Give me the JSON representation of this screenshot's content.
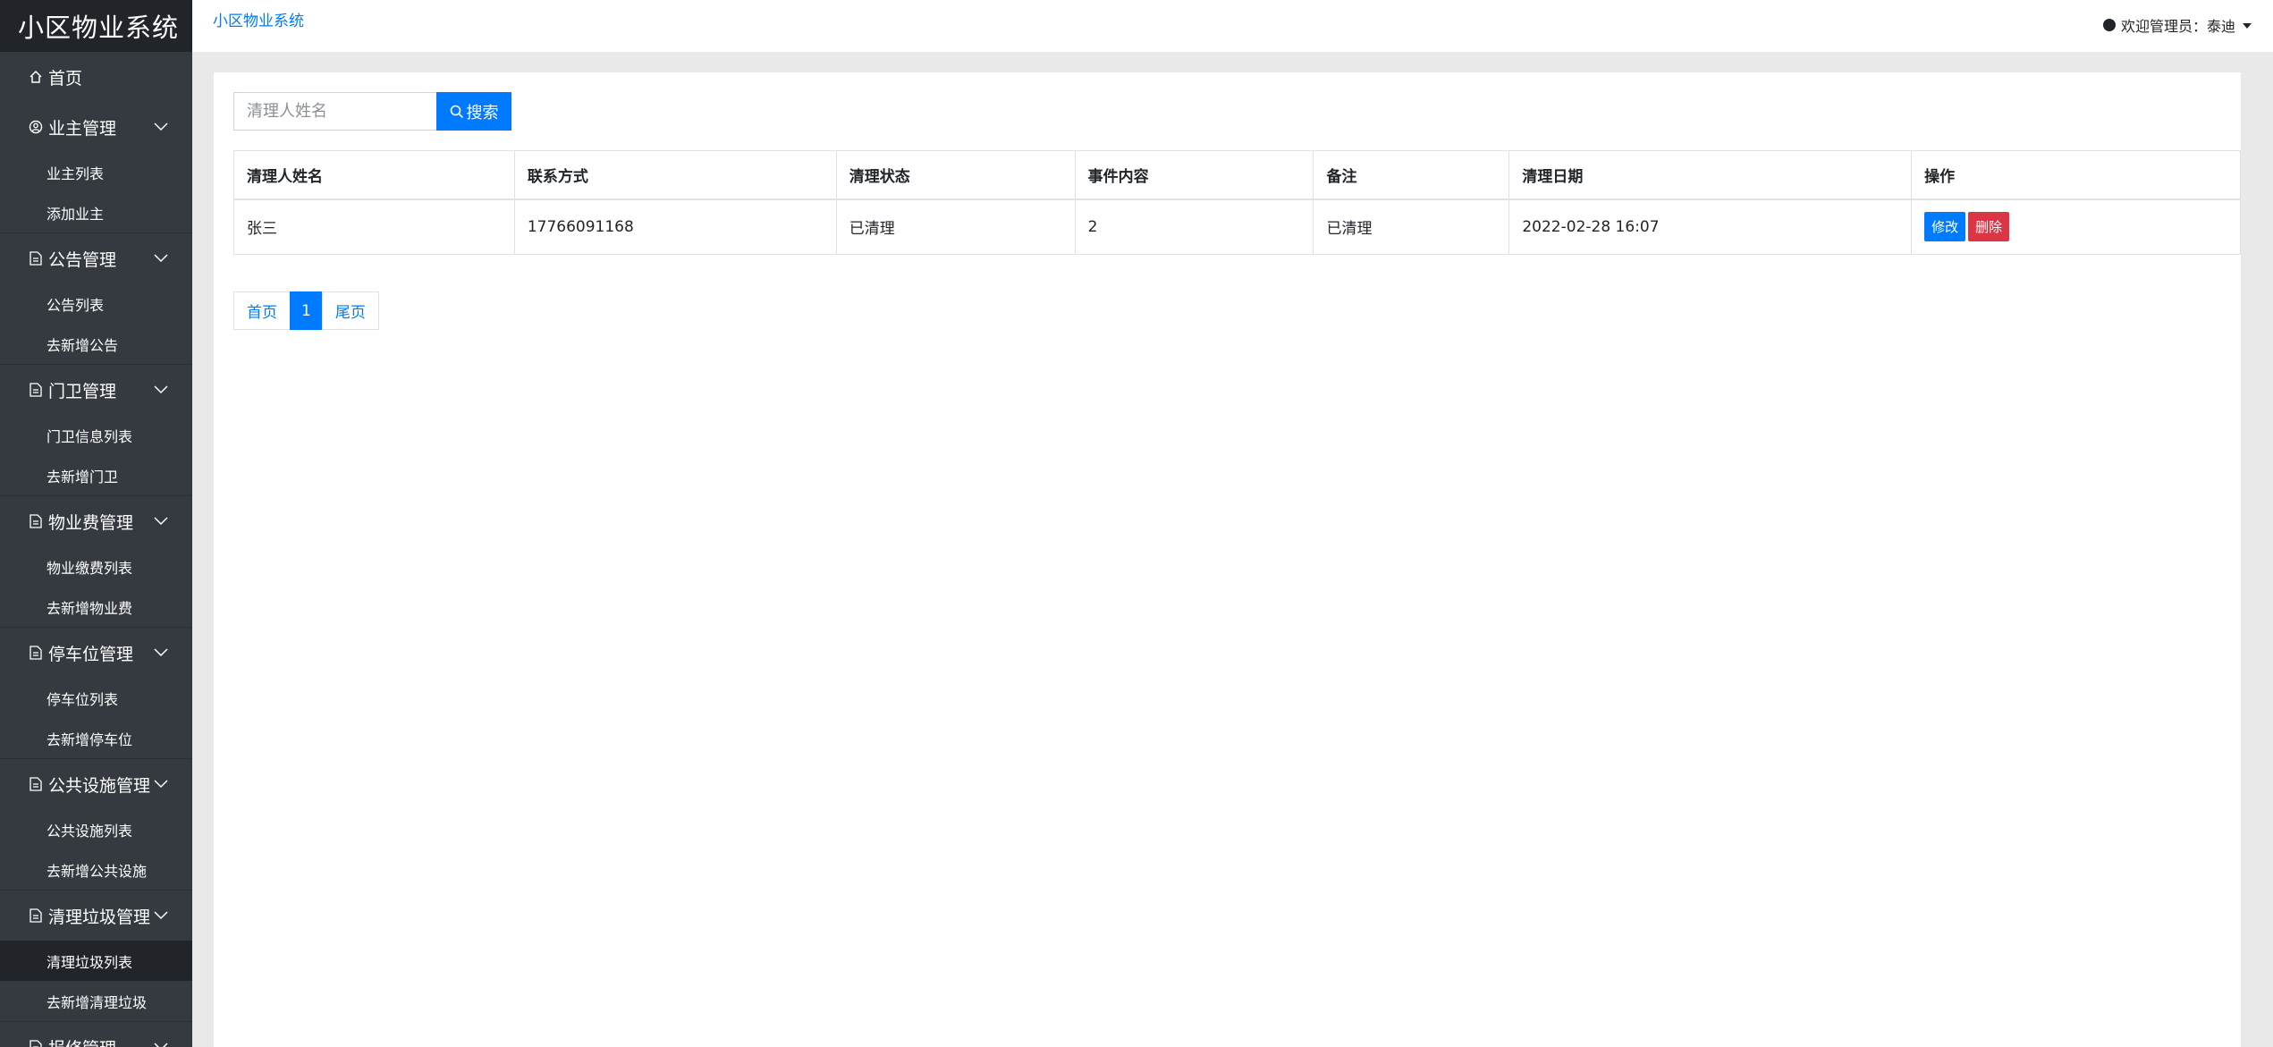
{
  "app": {
    "title": "小区物业系统"
  },
  "sidebar": {
    "home": "首页",
    "groups": [
      {
        "label": "业主管理",
        "icon": "user-circle-icon",
        "items": [
          "业主列表",
          "添加业主"
        ]
      },
      {
        "label": "公告管理",
        "icon": "document-icon",
        "items": [
          "公告列表",
          "去新增公告"
        ]
      },
      {
        "label": "门卫管理",
        "icon": "document-icon",
        "items": [
          "门卫信息列表",
          "去新增门卫"
        ]
      },
      {
        "label": "物业费管理",
        "icon": "document-icon",
        "items": [
          "物业缴费列表",
          "去新增物业费"
        ]
      },
      {
        "label": "停车位管理",
        "icon": "document-icon",
        "items": [
          "停车位列表",
          "去新增停车位"
        ]
      },
      {
        "label": "公共设施管理",
        "icon": "document-icon",
        "items": [
          "公共设施列表",
          "去新增公共设施"
        ]
      },
      {
        "label": "清理垃圾管理",
        "icon": "document-icon",
        "items": [
          "清理垃圾列表",
          "去新增清理垃圾"
        ]
      },
      {
        "label": "报修管理",
        "icon": "document-icon",
        "items": []
      }
    ],
    "active_item": "清理垃圾列表"
  },
  "header": {
    "breadcrumb": "小区物业系统",
    "welcome": "欢迎管理员：泰迪"
  },
  "search": {
    "placeholder": "清理人姓名",
    "value": "",
    "button_label": "搜索"
  },
  "table": {
    "columns": [
      "清理人姓名",
      "联系方式",
      "清理状态",
      "事件内容",
      "备注",
      "清理日期",
      "操作"
    ],
    "rows": [
      {
        "name": "张三",
        "phone": "17766091168",
        "status": "已清理",
        "content": "2",
        "remark": "已清理",
        "date": "2022-02-28 16:07"
      }
    ],
    "edit_label": "修改",
    "delete_label": "删除"
  },
  "pagination": {
    "first": "首页",
    "current": "1",
    "last": "尾页"
  },
  "colors": {
    "sidebar_bg": "#343a40",
    "brand_bg": "#212529",
    "primary": "#007bff",
    "danger": "#dc3545"
  }
}
